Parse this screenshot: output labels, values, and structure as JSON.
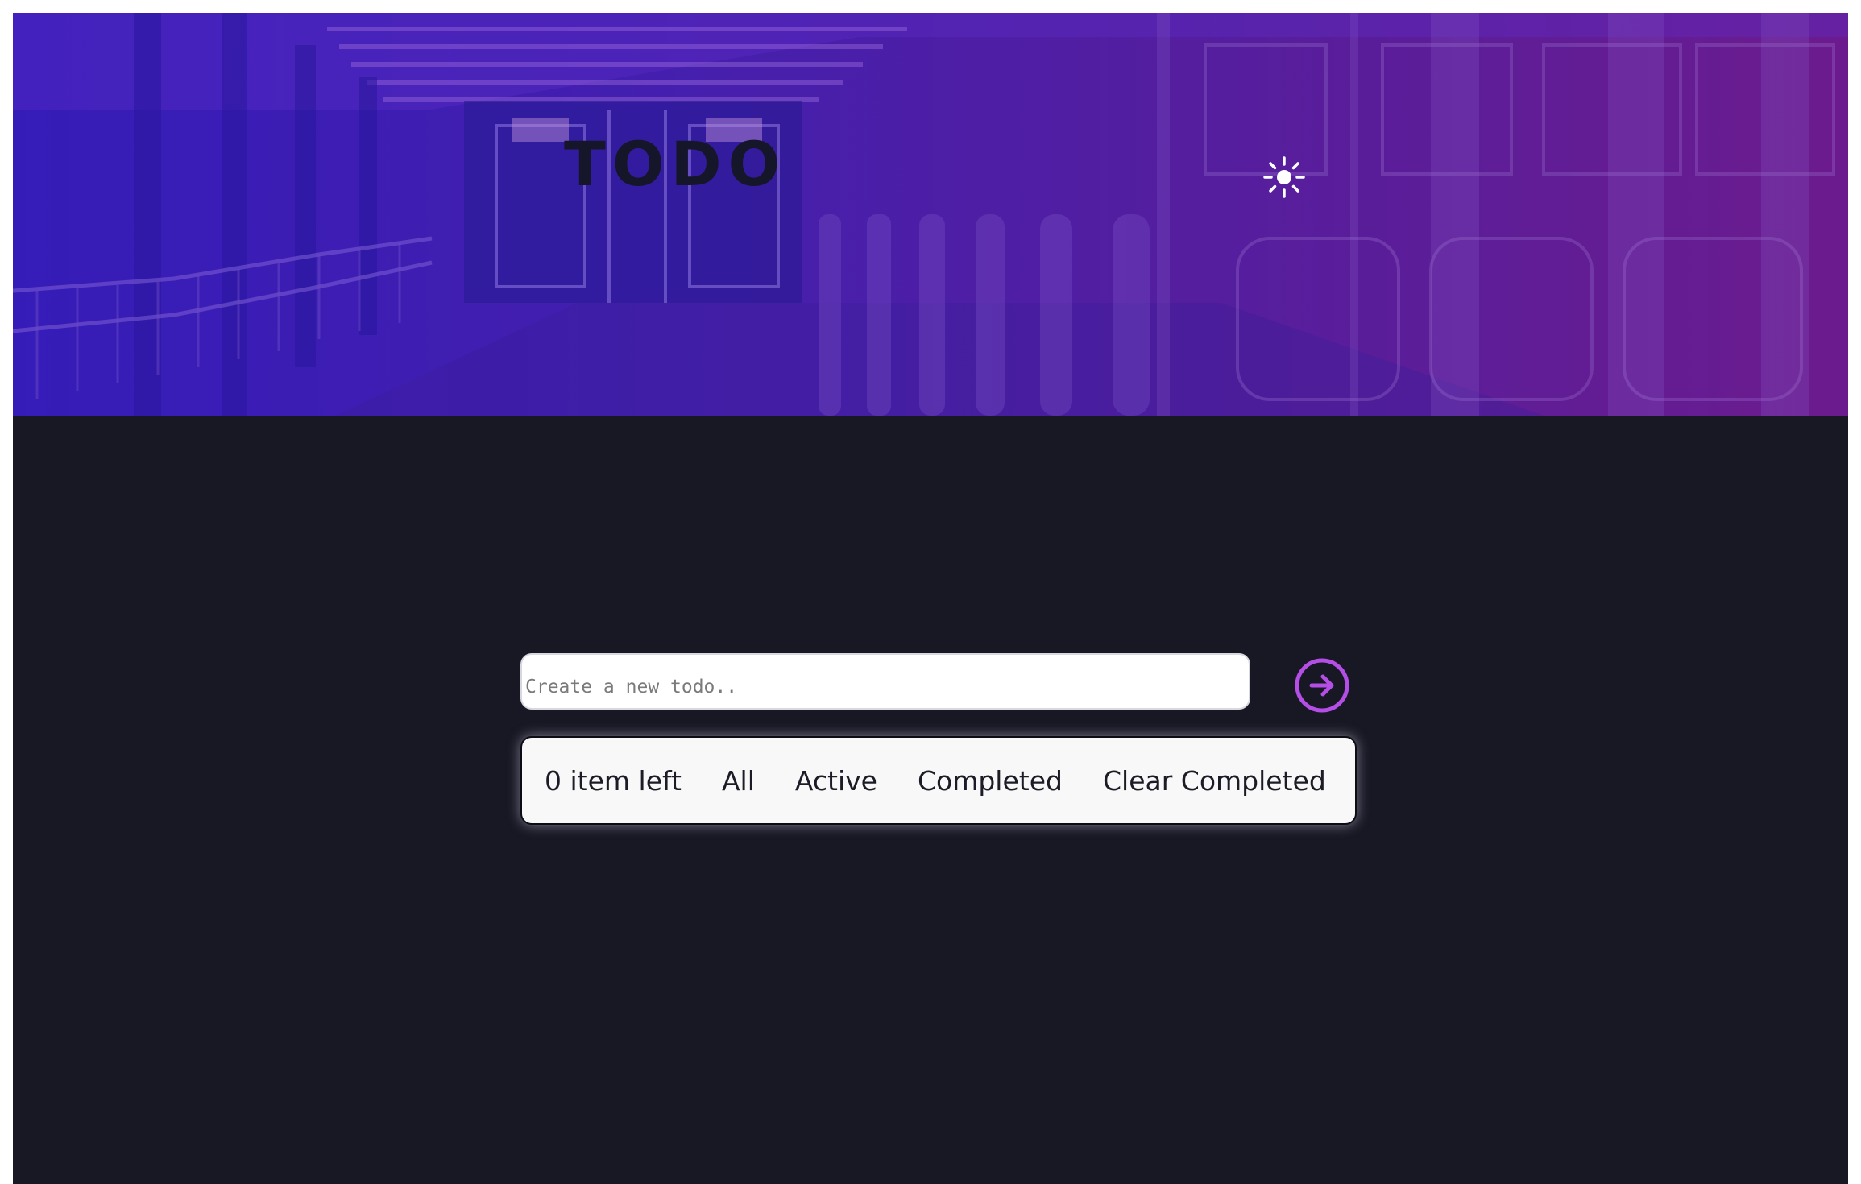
{
  "header": {
    "title": "TODO",
    "theme_toggle_icon": "sun-icon"
  },
  "new_todo": {
    "placeholder": "Create a new todo..",
    "value": "",
    "submit_icon": "arrow-right-circle-icon"
  },
  "footer": {
    "items_left": "0 item left",
    "filters": {
      "all": "All",
      "active": "Active",
      "completed": "Completed"
    },
    "clear_completed": "Clear Completed"
  },
  "colors": {
    "background": "#181824",
    "hero_gradient_start": "#3a20c6",
    "hero_gradient_end": "#7a1f94",
    "accent": "#b54ee6",
    "card": "#f8f8f8",
    "text_dark": "#1c1c26"
  }
}
